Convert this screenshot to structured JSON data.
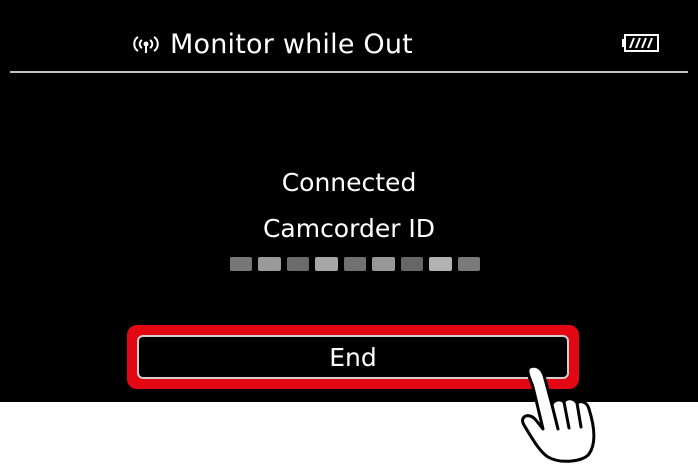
{
  "header": {
    "title": "Monitor while Out",
    "left_icon": "wireless-signal-icon",
    "right_icon": "battery-icon"
  },
  "status": {
    "connected_label": "Connected",
    "camcorder_id_label": "Camcorder ID"
  },
  "actions": {
    "end_label": "End"
  },
  "colors": {
    "highlight": "#e30613",
    "screen_background": "#000000",
    "text": "#ffffff"
  }
}
